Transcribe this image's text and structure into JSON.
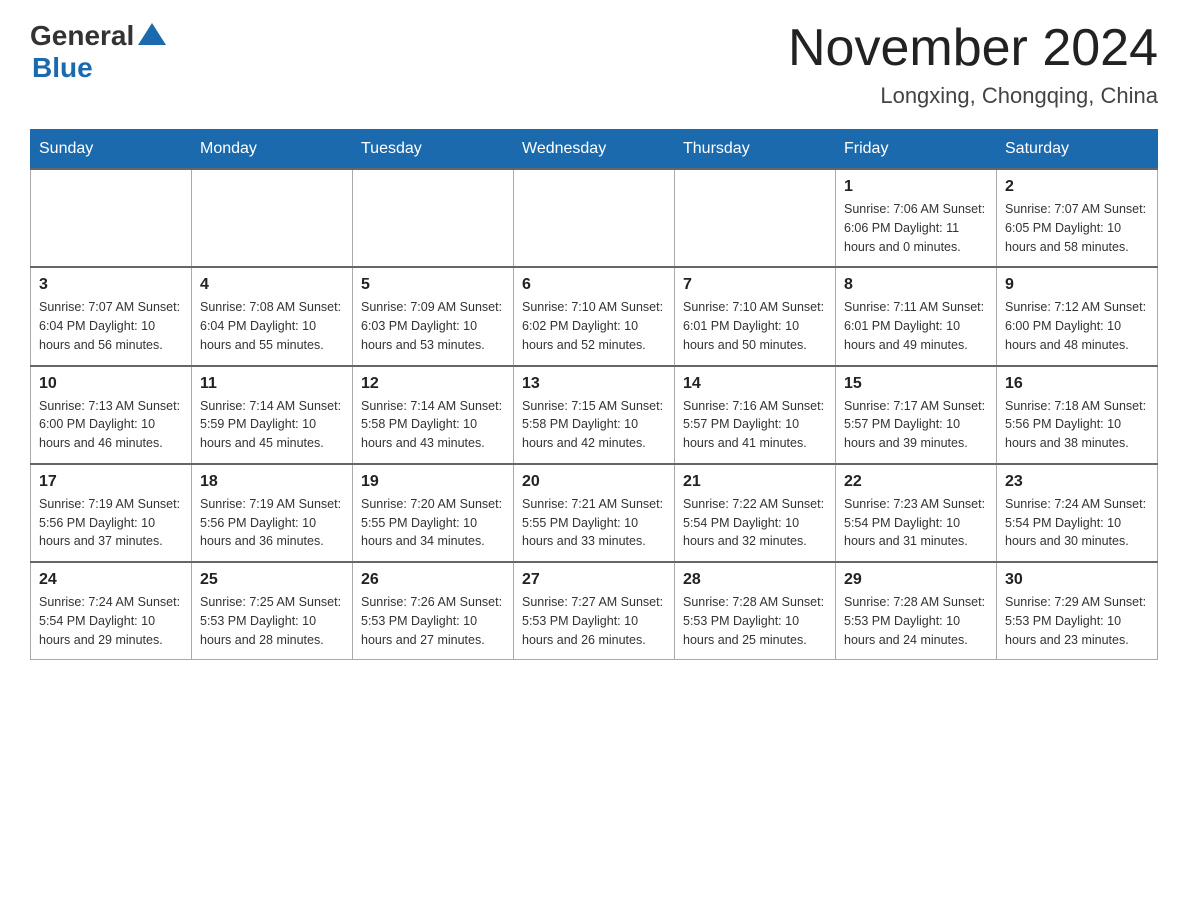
{
  "header": {
    "logo_general": "General",
    "logo_blue": "Blue",
    "month_title": "November 2024",
    "location": "Longxing, Chongqing, China"
  },
  "weekdays": [
    "Sunday",
    "Monday",
    "Tuesday",
    "Wednesday",
    "Thursday",
    "Friday",
    "Saturday"
  ],
  "weeks": [
    [
      {
        "day": "",
        "info": ""
      },
      {
        "day": "",
        "info": ""
      },
      {
        "day": "",
        "info": ""
      },
      {
        "day": "",
        "info": ""
      },
      {
        "day": "",
        "info": ""
      },
      {
        "day": "1",
        "info": "Sunrise: 7:06 AM\nSunset: 6:06 PM\nDaylight: 11 hours\nand 0 minutes."
      },
      {
        "day": "2",
        "info": "Sunrise: 7:07 AM\nSunset: 6:05 PM\nDaylight: 10 hours\nand 58 minutes."
      }
    ],
    [
      {
        "day": "3",
        "info": "Sunrise: 7:07 AM\nSunset: 6:04 PM\nDaylight: 10 hours\nand 56 minutes."
      },
      {
        "day": "4",
        "info": "Sunrise: 7:08 AM\nSunset: 6:04 PM\nDaylight: 10 hours\nand 55 minutes."
      },
      {
        "day": "5",
        "info": "Sunrise: 7:09 AM\nSunset: 6:03 PM\nDaylight: 10 hours\nand 53 minutes."
      },
      {
        "day": "6",
        "info": "Sunrise: 7:10 AM\nSunset: 6:02 PM\nDaylight: 10 hours\nand 52 minutes."
      },
      {
        "day": "7",
        "info": "Sunrise: 7:10 AM\nSunset: 6:01 PM\nDaylight: 10 hours\nand 50 minutes."
      },
      {
        "day": "8",
        "info": "Sunrise: 7:11 AM\nSunset: 6:01 PM\nDaylight: 10 hours\nand 49 minutes."
      },
      {
        "day": "9",
        "info": "Sunrise: 7:12 AM\nSunset: 6:00 PM\nDaylight: 10 hours\nand 48 minutes."
      }
    ],
    [
      {
        "day": "10",
        "info": "Sunrise: 7:13 AM\nSunset: 6:00 PM\nDaylight: 10 hours\nand 46 minutes."
      },
      {
        "day": "11",
        "info": "Sunrise: 7:14 AM\nSunset: 5:59 PM\nDaylight: 10 hours\nand 45 minutes."
      },
      {
        "day": "12",
        "info": "Sunrise: 7:14 AM\nSunset: 5:58 PM\nDaylight: 10 hours\nand 43 minutes."
      },
      {
        "day": "13",
        "info": "Sunrise: 7:15 AM\nSunset: 5:58 PM\nDaylight: 10 hours\nand 42 minutes."
      },
      {
        "day": "14",
        "info": "Sunrise: 7:16 AM\nSunset: 5:57 PM\nDaylight: 10 hours\nand 41 minutes."
      },
      {
        "day": "15",
        "info": "Sunrise: 7:17 AM\nSunset: 5:57 PM\nDaylight: 10 hours\nand 39 minutes."
      },
      {
        "day": "16",
        "info": "Sunrise: 7:18 AM\nSunset: 5:56 PM\nDaylight: 10 hours\nand 38 minutes."
      }
    ],
    [
      {
        "day": "17",
        "info": "Sunrise: 7:19 AM\nSunset: 5:56 PM\nDaylight: 10 hours\nand 37 minutes."
      },
      {
        "day": "18",
        "info": "Sunrise: 7:19 AM\nSunset: 5:56 PM\nDaylight: 10 hours\nand 36 minutes."
      },
      {
        "day": "19",
        "info": "Sunrise: 7:20 AM\nSunset: 5:55 PM\nDaylight: 10 hours\nand 34 minutes."
      },
      {
        "day": "20",
        "info": "Sunrise: 7:21 AM\nSunset: 5:55 PM\nDaylight: 10 hours\nand 33 minutes."
      },
      {
        "day": "21",
        "info": "Sunrise: 7:22 AM\nSunset: 5:54 PM\nDaylight: 10 hours\nand 32 minutes."
      },
      {
        "day": "22",
        "info": "Sunrise: 7:23 AM\nSunset: 5:54 PM\nDaylight: 10 hours\nand 31 minutes."
      },
      {
        "day": "23",
        "info": "Sunrise: 7:24 AM\nSunset: 5:54 PM\nDaylight: 10 hours\nand 30 minutes."
      }
    ],
    [
      {
        "day": "24",
        "info": "Sunrise: 7:24 AM\nSunset: 5:54 PM\nDaylight: 10 hours\nand 29 minutes."
      },
      {
        "day": "25",
        "info": "Sunrise: 7:25 AM\nSunset: 5:53 PM\nDaylight: 10 hours\nand 28 minutes."
      },
      {
        "day": "26",
        "info": "Sunrise: 7:26 AM\nSunset: 5:53 PM\nDaylight: 10 hours\nand 27 minutes."
      },
      {
        "day": "27",
        "info": "Sunrise: 7:27 AM\nSunset: 5:53 PM\nDaylight: 10 hours\nand 26 minutes."
      },
      {
        "day": "28",
        "info": "Sunrise: 7:28 AM\nSunset: 5:53 PM\nDaylight: 10 hours\nand 25 minutes."
      },
      {
        "day": "29",
        "info": "Sunrise: 7:28 AM\nSunset: 5:53 PM\nDaylight: 10 hours\nand 24 minutes."
      },
      {
        "day": "30",
        "info": "Sunrise: 7:29 AM\nSunset: 5:53 PM\nDaylight: 10 hours\nand 23 minutes."
      }
    ]
  ]
}
